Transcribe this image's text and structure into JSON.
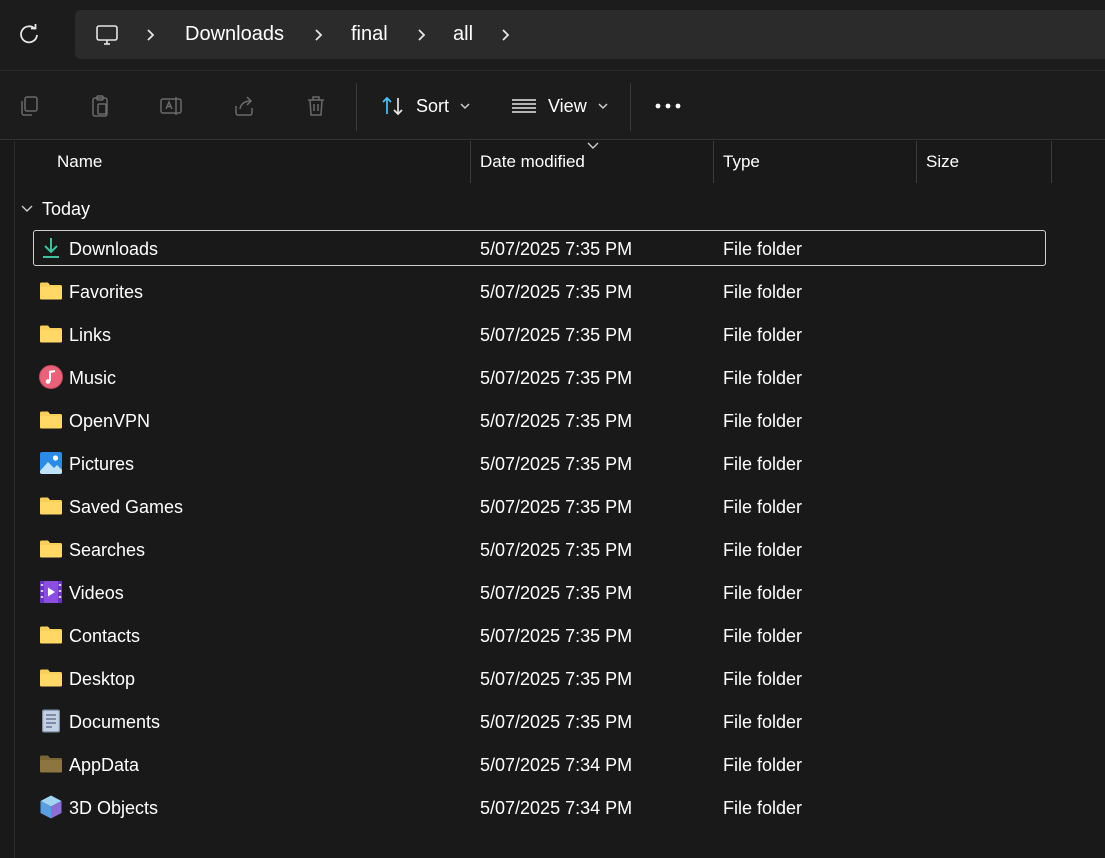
{
  "breadcrumb": {
    "items": [
      "Downloads",
      "final",
      "all"
    ]
  },
  "toolbar": {
    "sort_label": "Sort",
    "view_label": "View"
  },
  "columns": {
    "name": "Name",
    "date": "Date modified",
    "type": "Type",
    "size": "Size"
  },
  "group": {
    "label": "Today"
  },
  "rows": [
    {
      "name": "Downloads",
      "date": "5/07/2025 7:35 PM",
      "type": "File folder",
      "size": "",
      "icon": "download-icon"
    },
    {
      "name": "Favorites",
      "date": "5/07/2025 7:35 PM",
      "type": "File folder",
      "size": "",
      "icon": "folder-icon"
    },
    {
      "name": "Links",
      "date": "5/07/2025 7:35 PM",
      "type": "File folder",
      "size": "",
      "icon": "folder-icon"
    },
    {
      "name": "Music",
      "date": "5/07/2025 7:35 PM",
      "type": "File folder",
      "size": "",
      "icon": "music-icon"
    },
    {
      "name": "OpenVPN",
      "date": "5/07/2025 7:35 PM",
      "type": "File folder",
      "size": "",
      "icon": "folder-icon"
    },
    {
      "name": "Pictures",
      "date": "5/07/2025 7:35 PM",
      "type": "File folder",
      "size": "",
      "icon": "pictures-icon"
    },
    {
      "name": "Saved Games",
      "date": "5/07/2025 7:35 PM",
      "type": "File folder",
      "size": "",
      "icon": "folder-icon"
    },
    {
      "name": "Searches",
      "date": "5/07/2025 7:35 PM",
      "type": "File folder",
      "size": "",
      "icon": "folder-icon"
    },
    {
      "name": "Videos",
      "date": "5/07/2025 7:35 PM",
      "type": "File folder",
      "size": "",
      "icon": "videos-icon"
    },
    {
      "name": "Contacts",
      "date": "5/07/2025 7:35 PM",
      "type": "File folder",
      "size": "",
      "icon": "folder-icon"
    },
    {
      "name": "Desktop",
      "date": "5/07/2025 7:35 PM",
      "type": "File folder",
      "size": "",
      "icon": "folder-icon"
    },
    {
      "name": "Documents",
      "date": "5/07/2025 7:35 PM",
      "type": "File folder",
      "size": "",
      "icon": "documents-icon"
    },
    {
      "name": "AppData",
      "date": "5/07/2025 7:34 PM",
      "type": "File folder",
      "size": "",
      "icon": "hidden-folder-icon"
    },
    {
      "name": "3D Objects",
      "date": "5/07/2025 7:34 PM",
      "type": "File folder",
      "size": "",
      "icon": "3d-objects-icon"
    }
  ],
  "colors": {
    "background": "#191919",
    "folder": "#f8cf5a",
    "accent": "#4cc2ff",
    "selection_border": "#cfcfcf"
  }
}
